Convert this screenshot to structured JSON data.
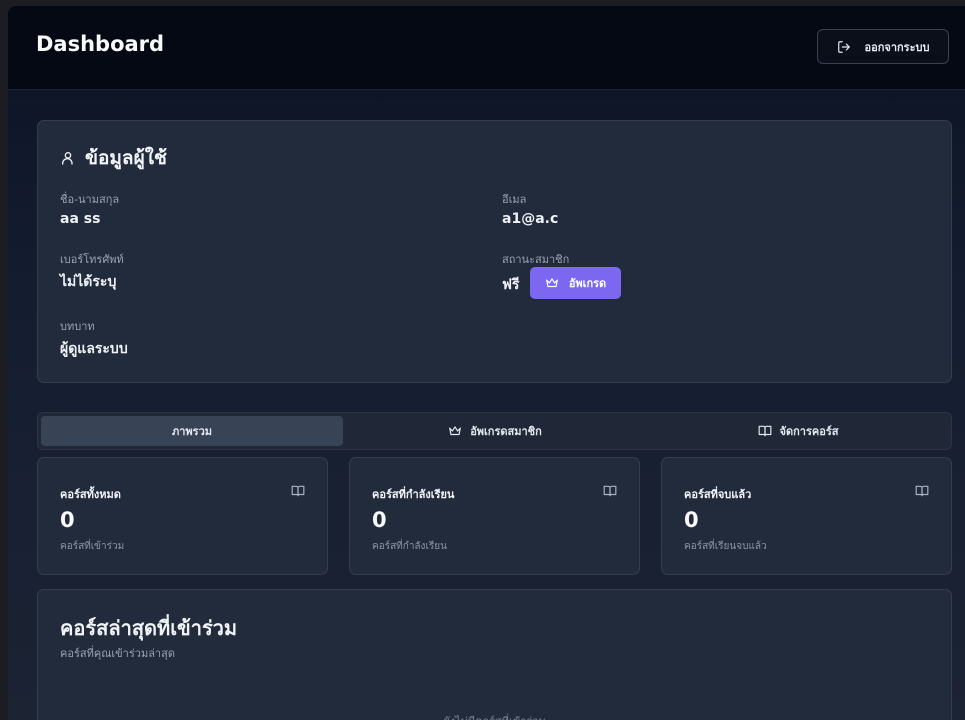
{
  "header": {
    "title": "Dashboard",
    "logout_label": "ออกจากระบบ"
  },
  "user_info": {
    "title": "ข้อมูลผู้ใช้",
    "fields": [
      {
        "label": "ชื่อ-นามสกุล",
        "value": "aa ss"
      },
      {
        "label": "อีเมล",
        "value": "a1@a.c"
      },
      {
        "label": "เบอร์โทรศัพท์",
        "value": "ไม่ได้ระบุ"
      },
      {
        "label": "สถานะสมาชิก",
        "value": "ฟรี"
      },
      {
        "label": "บทบาท",
        "value": "ผู้ดูแลระบบ"
      }
    ],
    "upgrade_label": "อัพเกรด"
  },
  "tabs": [
    {
      "label": "ภาพรวม",
      "icon": null,
      "active": true
    },
    {
      "label": "อัพเกรดสมาชิก",
      "icon": "crown-icon",
      "active": false
    },
    {
      "label": "จัดการคอร์ส",
      "icon": "book-open-icon",
      "active": false
    }
  ],
  "stats": [
    {
      "title": "คอร์สทั้งหมด",
      "value": "0",
      "subtitle": "คอร์สที่เข้าร่วม",
      "icon": "book-open-icon"
    },
    {
      "title": "คอร์สที่กำลังเรียน",
      "value": "0",
      "subtitle": "คอร์สที่กำลังเรียน",
      "icon": "book-open-icon"
    },
    {
      "title": "คอร์สที่จบแล้ว",
      "value": "0",
      "subtitle": "คอร์สที่เรียนจบแล้ว",
      "icon": "book-open-icon"
    }
  ],
  "recent": {
    "title": "คอร์สล่าสุดที่เข้าร่วม",
    "subtitle": "คอร์สที่คุณเข้าร่วมล่าสุด",
    "empty_text": "ยังไม่มีคอร์สที่เข้าร่วม"
  },
  "colors": {
    "accent": "#7b67f0",
    "background": "#0b1222",
    "card": "#222b3b"
  }
}
